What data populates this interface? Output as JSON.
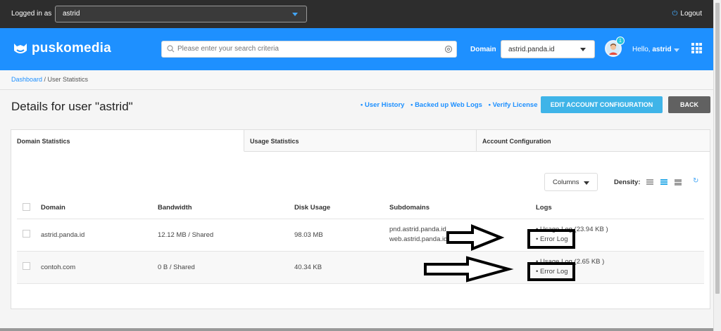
{
  "topbar": {
    "logged_in_label": "Logged in as",
    "user_value": "astrid",
    "logout_label": "Logout"
  },
  "brand": {
    "name": "puskomedia",
    "search_placeholder": "Please enter your search criteria",
    "domain_label": "Domain",
    "domain_value": "astrid.panda.id",
    "notification_count": "1",
    "hello_prefix": "Hello,",
    "hello_user": "astrid",
    "accent": "#1e90ff"
  },
  "breadcrumb": {
    "home": "Dashboard",
    "separator": " / ",
    "current": "User Statistics"
  },
  "page": {
    "title": "Details for user \"astrid\"",
    "links": [
      "• User History",
      "• Backed up Web Logs",
      "• Verify License"
    ],
    "edit_button": "EDIT ACCOUNT CONFIGURATION",
    "back_button": "BACK"
  },
  "tabs": [
    "Domain Statistics",
    "Usage Statistics",
    "Account Configuration"
  ],
  "toolbar": {
    "columns_label": "Columns",
    "density_label": "Density:"
  },
  "table": {
    "headers": [
      "Domain",
      "Bandwidth",
      "Disk Usage",
      "Subdomains",
      "Logs"
    ],
    "rows": [
      {
        "domain": "astrid.panda.id",
        "bandwidth": "12.12 MB / Shared",
        "disk": "98.03 MB",
        "subdomains": [
          "pnd.astrid.panda.id",
          "web.astrid.panda.id"
        ],
        "logs": [
          "• Usage Log (23.94 KB )",
          "• Error Log"
        ]
      },
      {
        "domain": "contoh.com",
        "bandwidth": "0 B / Shared",
        "disk": "40.34 KB",
        "subdomains": [],
        "logs": [
          "• Usage Log (2.65 KB )",
          "• Error Log"
        ]
      }
    ]
  }
}
